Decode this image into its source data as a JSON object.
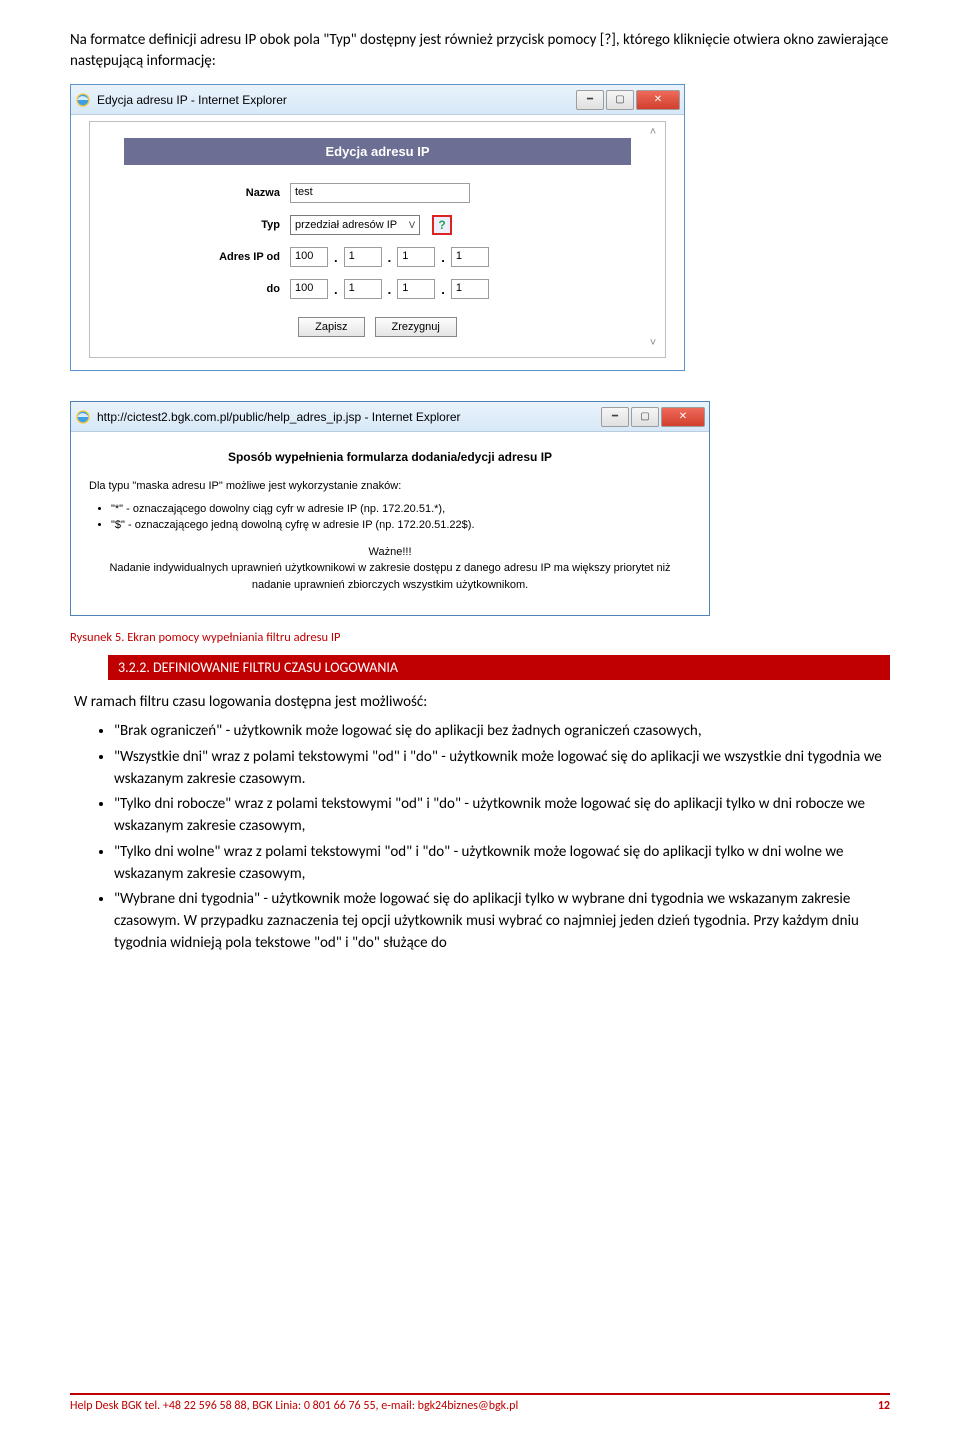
{
  "intro": "Na formatce definicji adresu IP obok pola \"Typ\" dostępny jest również przycisk pomocy [?], którego kliknięcie otwiera okno zawierające następującą informację:",
  "window1": {
    "title": "Edycja adresu IP - Internet Explorer",
    "banner": "Edycja adresu IP",
    "labels": {
      "nazwa": "Nazwa",
      "typ": "Typ",
      "adres_od": "Adres IP od",
      "do": "do"
    },
    "values": {
      "nazwa": "test",
      "typ": "przedział adresów IP",
      "ip_od": [
        "100",
        "1",
        "1",
        "1"
      ],
      "ip_do": [
        "100",
        "1",
        "1",
        "1"
      ]
    },
    "buttons": {
      "zapisz": "Zapisz",
      "zrezygnuj": "Zrezygnuj"
    },
    "help_symbol": "?"
  },
  "window2": {
    "title": "http://cictest2.bgk.com.pl/public/help_adres_ip.jsp - Internet Explorer",
    "heading": "Sposób wypełnienia formularza dodania/edycji adresu IP",
    "line1": "Dla typu \"maska adresu IP\" możliwe jest wykorzystanie znaków:",
    "bullet1": "\"*\" - oznaczającego dowolny ciąg cyfr w adresie IP (np. 172.20.51.*),",
    "bullet2": "\"$\" - oznaczającego jedną dowolną cyfrę w adresie IP (np. 172.20.51.22$).",
    "wazne_hdr": "Ważne!!!",
    "wazne_txt": "Nadanie indywidualnych uprawnień użytkownikowi w zakresie dostępu z danego adresu IP ma większy priorytet niż nadanie uprawnień zbiorczych wszystkim użytkownikom."
  },
  "caption": "Rysunek 5. Ekran pomocy wypełniania filtru adresu IP",
  "section_header": "3.2.2. DEFINIOWANIE FILTRU CZASU LOGOWANIA",
  "body_intro": "W ramach filtru czasu logowania  dostępna jest możliwość:",
  "bullets": [
    "\"Brak ograniczeń\" - użytkownik może logować się do aplikacji bez żadnych ograniczeń czasowych,",
    "\"Wszystkie dni\" wraz z polami tekstowymi \"od\" i \"do\" - użytkownik może logować się do aplikacji we wszystkie dni tygodnia we wskazanym zakresie czasowym.",
    "\"Tylko dni robocze\" wraz z polami tekstowymi \"od\" i \"do\" - użytkownik może logować się do aplikacji tylko w dni robocze we wskazanym zakresie czasowym,",
    "\"Tylko dni wolne\" wraz z polami tekstowymi \"od\" i \"do\" - użytkownik może logować się do aplikacji tylko w dni wolne we wskazanym zakresie czasowym,",
    "\"Wybrane dni tygodnia\" - użytkownik może logować się do aplikacji tylko w wybrane dni tygodnia we wskazanym zakresie czasowym. W przypadku zaznaczenia tej opcji użytkownik musi wybrać co najmniej jeden dzień tygodnia. Przy każdym dniu tygodnia widnieją pola tekstowe \"od\" i \"do\" służące do"
  ],
  "footer": {
    "left": "Help Desk BGK tel. +48  22 596 58 88, BGK Linia: 0 801 66 76 55, e-mail: bgk24biznes@bgk.pl",
    "page": "12"
  }
}
